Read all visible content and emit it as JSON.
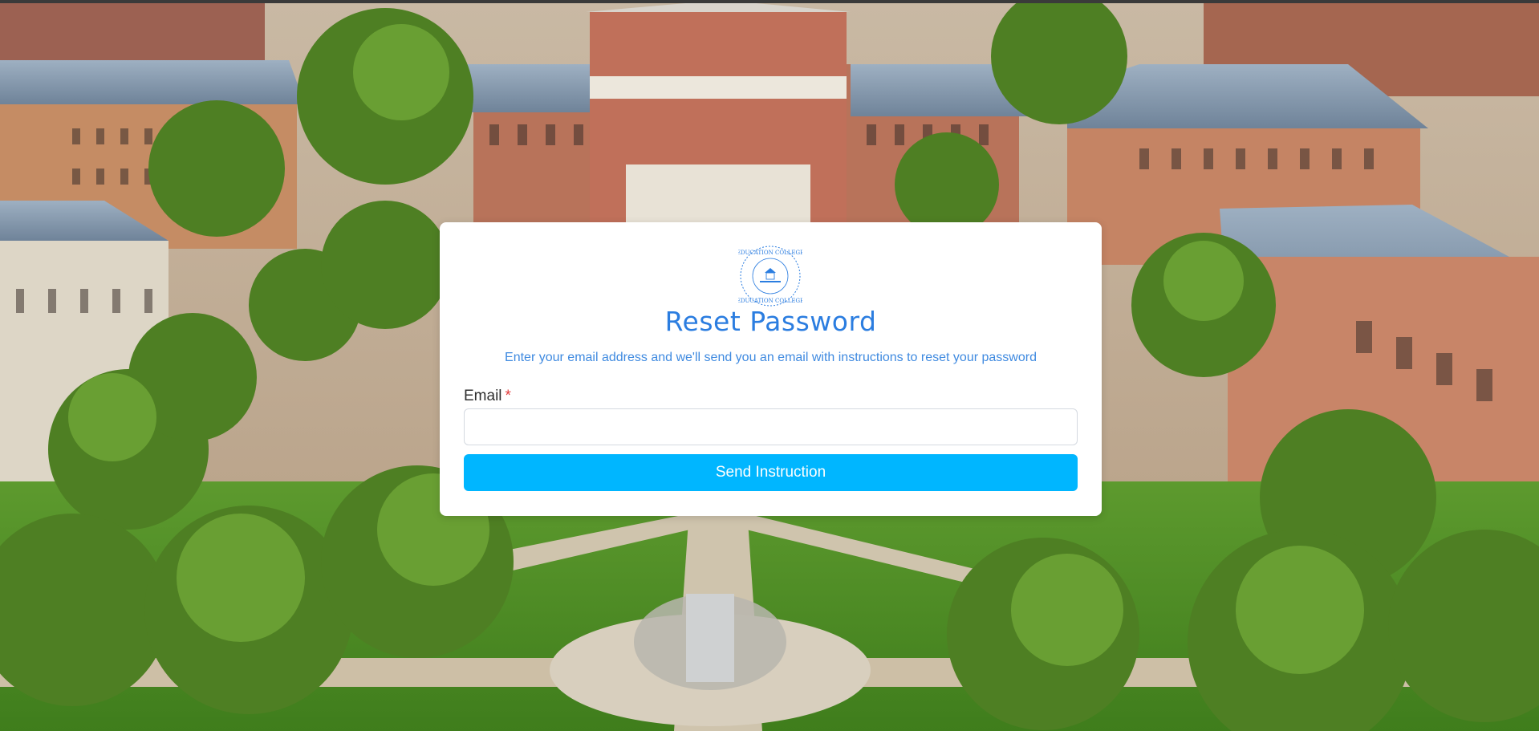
{
  "logo": {
    "ring_text": "EDUCATION COLLEGE",
    "icon": "college-seal-icon"
  },
  "reset": {
    "title": "Reset Password",
    "subtitle": "Enter your email address and we'll send you an email with instructions to reset your password",
    "email_label": "Email",
    "required_mark": "*",
    "email_value": "",
    "email_placeholder": "",
    "submit_label": "Send Instruction"
  },
  "colors": {
    "title": "#2b7de0",
    "subtitle": "#3f8ae0",
    "button": "#00b6ff",
    "required": "#e23b3b"
  }
}
